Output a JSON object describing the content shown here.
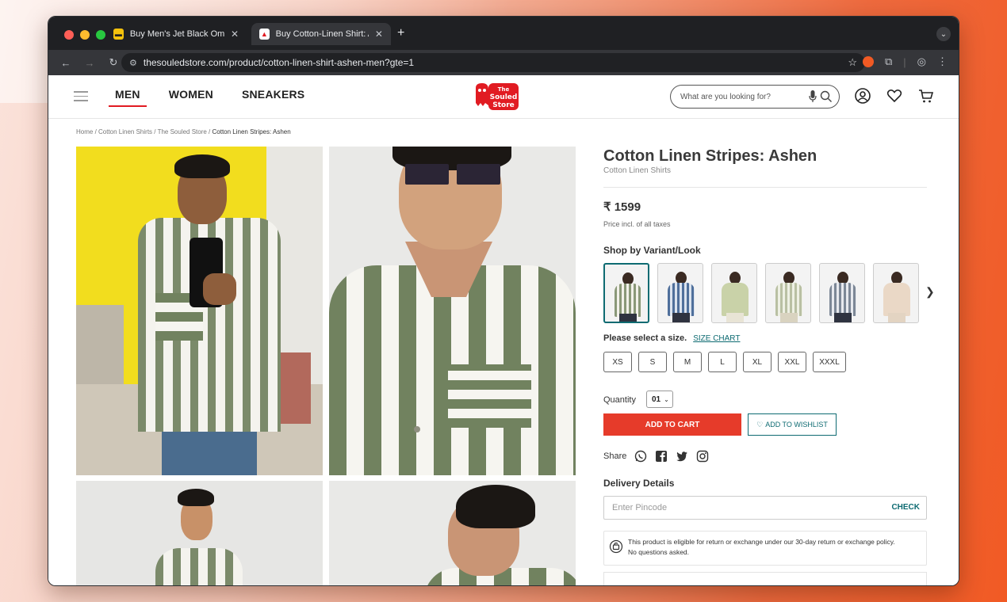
{
  "browser": {
    "tabs": [
      {
        "title": "Buy Men's Jet Black Ombre C",
        "favicon_color": "#f4c20d"
      },
      {
        "title": "Buy Cotton-Linen Shirt: Ashe",
        "favicon_color": "#e11b22"
      }
    ],
    "url": "thesouledstore.com/product/cotton-linen-shirt-ashen-men?gte=1"
  },
  "site": {
    "nav": [
      "MEN",
      "WOMEN",
      "SNEAKERS"
    ],
    "logo_text_1": "The",
    "logo_text_2": "Souled",
    "logo_text_3": "Store",
    "search_placeholder": "What are you looking for?"
  },
  "breadcrumb": {
    "trail": "Home / Cotton Linen Shirts / The Souled Store / ",
    "current": "Cotton Linen Stripes: Ashen"
  },
  "product": {
    "title": "Cotton Linen Stripes: Ashen",
    "category": "Cotton Linen Shirts",
    "price": "₹ 1599",
    "tax_note": "Price incl. of all taxes",
    "variant_heading": "Shop by Variant/Look",
    "variants": [
      {
        "shirt": "#8a9878",
        "selected": true
      },
      {
        "shirt": "#4f6f9b",
        "selected": false
      },
      {
        "shirt": "#c9d2a8",
        "selected": false
      },
      {
        "shirt": "#b9c0a3",
        "selected": false
      },
      {
        "shirt": "#7c8796",
        "selected": false
      },
      {
        "shirt": "#ead8c6",
        "selected": false
      }
    ],
    "size_heading": "Please select a size.",
    "size_chart": "SIZE CHART",
    "sizes": [
      "XS",
      "S",
      "M",
      "L",
      "XL",
      "XXL",
      "XXXL"
    ],
    "quantity_label": "Quantity",
    "quantity_value": "01",
    "add_to_cart": "ADD TO CART",
    "add_to_wishlist": "ADD TO WISHLIST",
    "share_label": "Share",
    "delivery_heading": "Delivery Details",
    "pincode_placeholder": "Enter Pincode",
    "check": "CHECK",
    "policy_line1": "This product is eligible for return or exchange under our 30-day return or exchange policy.",
    "policy_line2": "No questions asked."
  },
  "colors": {
    "accent_red": "#e63b2a",
    "teal": "#0e6b72"
  }
}
